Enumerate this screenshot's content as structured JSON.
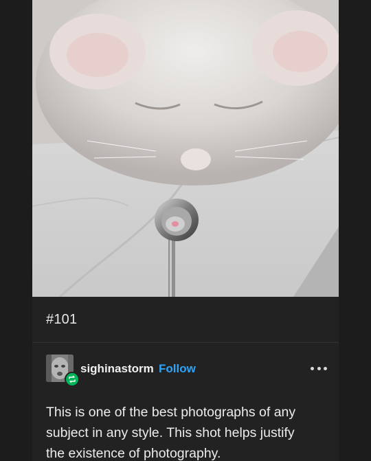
{
  "post": {
    "image": {
      "subject": "cat-looking-at-spoon-reflection"
    },
    "tags": [
      "#101"
    ],
    "reblog": {
      "username": "sighinastorm",
      "follow_label": "Follow",
      "body_line_1": "This is one of the best photographs of any",
      "body_line_2": "subject in any style.  This shot helps justify",
      "body_line_3": "the existence of photography."
    }
  },
  "icons": {
    "avatar": "user-avatar",
    "reblog_badge": "reblog-icon",
    "more": "ellipsis-icon"
  },
  "colors": {
    "background": "#1c1c1c",
    "card": "#222222",
    "follow": "#2fa3f7",
    "reblog_badge": "#00b45a",
    "text": "#ececec"
  }
}
